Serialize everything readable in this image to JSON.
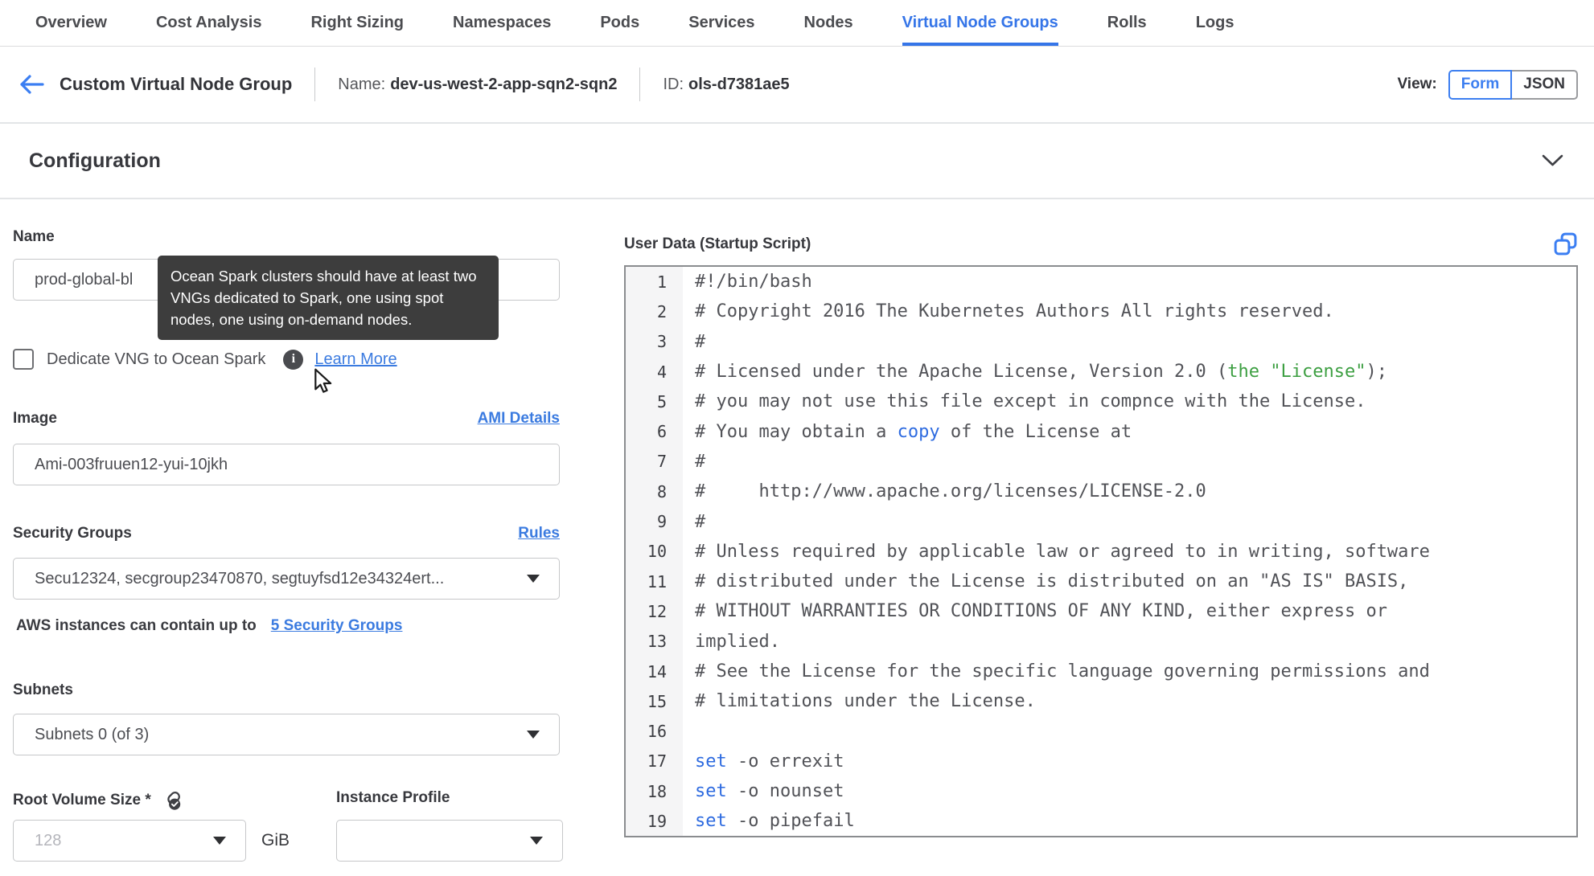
{
  "colors": {
    "accent_blue": "#3b7ef2",
    "tab_active_blue": "#3575e8",
    "link_blue": "#3b7be0",
    "tooltip_bg": "#3d3d3d",
    "code_green": "#3d9f42",
    "code_blue": "#2e6be0",
    "divider": "#e3e5e7"
  },
  "tabs": {
    "items": [
      {
        "label": "Overview",
        "active": false
      },
      {
        "label": "Cost Analysis",
        "active": false
      },
      {
        "label": "Right Sizing",
        "active": false
      },
      {
        "label": "Namespaces",
        "active": false
      },
      {
        "label": "Pods",
        "active": false
      },
      {
        "label": "Services",
        "active": false
      },
      {
        "label": "Nodes",
        "active": false
      },
      {
        "label": "Virtual Node Groups",
        "active": true
      },
      {
        "label": "Rolls",
        "active": false
      },
      {
        "label": "Logs",
        "active": false
      }
    ]
  },
  "header": {
    "back_icon": "arrow-left-icon",
    "title": "Custom Virtual Node Group",
    "name_label": "Name:",
    "name_value": "dev-us-west-2-app-sqn2-sqn2",
    "id_label": "ID:",
    "id_value": "ols-d7381ae5",
    "view_label": "View:",
    "view_options": [
      {
        "label": "Form",
        "selected": true
      },
      {
        "label": "JSON",
        "selected": false
      }
    ]
  },
  "section": {
    "title": "Configuration",
    "collapse_icon": "chevron-down-icon"
  },
  "form": {
    "name": {
      "label": "Name",
      "value": "prod-global-bl"
    },
    "spark_tooltip": "Ocean Spark clusters should have at least two VNGs dedicated to Spark, one using spot nodes, one using on-demand nodes.",
    "dedicate": {
      "label": "Dedicate VNG to Ocean Spark",
      "checked": false,
      "info_icon": "info-icon",
      "learn_more_label": "Learn More"
    },
    "image": {
      "label": "Image",
      "details_link": "AMI Details",
      "value": "Ami-003fruuen12-yui-10jkh"
    },
    "security_groups": {
      "label": "Security Groups",
      "rules_link": "Rules",
      "value": "Secu12324, secgroup23470870, segtuyfsd12e34324ert...",
      "hint_text": "AWS instances can contain up to",
      "hint_link": "5 Security Groups"
    },
    "subnets": {
      "label": "Subnets",
      "value": "Subnets 0 (of 3)"
    },
    "root_volume": {
      "label": "Root Volume Size *",
      "link_icon": "link-check-icon",
      "placeholder": "128",
      "unit": "GiB"
    },
    "instance_profile": {
      "label": "Instance Profile",
      "value": ""
    }
  },
  "user_data": {
    "label": "User Data (Startup Script)",
    "copy_icon": "copy-icon",
    "code_lines": [
      {
        "num": 1,
        "segments": [
          {
            "text": "#!/bin/bash",
            "color": "default"
          }
        ]
      },
      {
        "num": 2,
        "segments": [
          {
            "text": "# Copyright 2016 The Kubernetes Authors All rights reserved.",
            "color": "default"
          }
        ]
      },
      {
        "num": 3,
        "segments": [
          {
            "text": "#",
            "color": "default"
          }
        ]
      },
      {
        "num": 4,
        "segments": [
          {
            "text": "# Licensed under the Apache License, Version 2.0 (",
            "color": "default"
          },
          {
            "text": "the \"License\"",
            "color": "green"
          },
          {
            "text": ");",
            "color": "default"
          }
        ]
      },
      {
        "num": 5,
        "segments": [
          {
            "text": "# you may not use this file except in compnce with the License.",
            "color": "default"
          }
        ]
      },
      {
        "num": 6,
        "segments": [
          {
            "text": "# You may obtain a ",
            "color": "default"
          },
          {
            "text": "copy",
            "color": "blue"
          },
          {
            "text": " of the License at",
            "color": "default"
          }
        ]
      },
      {
        "num": 7,
        "segments": [
          {
            "text": "#",
            "color": "default"
          }
        ]
      },
      {
        "num": 8,
        "segments": [
          {
            "text": "#     http://www.apache.org/licenses/LICENSE-2.0",
            "color": "default"
          }
        ]
      },
      {
        "num": 9,
        "segments": [
          {
            "text": "#",
            "color": "default"
          }
        ]
      },
      {
        "num": 10,
        "segments": [
          {
            "text": "# Unless required by applicable law or agreed to in writing, software",
            "color": "default"
          }
        ]
      },
      {
        "num": 11,
        "segments": [
          {
            "text": "# distributed under the License is distributed on an \"AS IS\" BASIS,",
            "color": "default"
          }
        ]
      },
      {
        "num": 12,
        "segments": [
          {
            "text": "# WITHOUT WARRANTIES OR CONDITIONS OF ANY KIND, either express or",
            "color": "default"
          }
        ]
      },
      {
        "num": 13,
        "segments": [
          {
            "text": "implied.",
            "color": "default"
          }
        ]
      },
      {
        "num": 14,
        "segments": [
          {
            "text": "# See the License for the specific language governing permissions and",
            "color": "default"
          }
        ]
      },
      {
        "num": 15,
        "segments": [
          {
            "text": "# limitations under the License.",
            "color": "default"
          }
        ]
      },
      {
        "num": 16,
        "segments": [
          {
            "text": "",
            "color": "default"
          }
        ]
      },
      {
        "num": 17,
        "segments": [
          {
            "text": "set",
            "color": "blue"
          },
          {
            "text": " -o errexit",
            "color": "default"
          }
        ]
      },
      {
        "num": 18,
        "segments": [
          {
            "text": "set",
            "color": "blue"
          },
          {
            "text": " -o nounset",
            "color": "default"
          }
        ]
      },
      {
        "num": 19,
        "segments": [
          {
            "text": "set",
            "color": "blue"
          },
          {
            "text": " -o pipefail",
            "color": "default"
          }
        ]
      }
    ]
  }
}
